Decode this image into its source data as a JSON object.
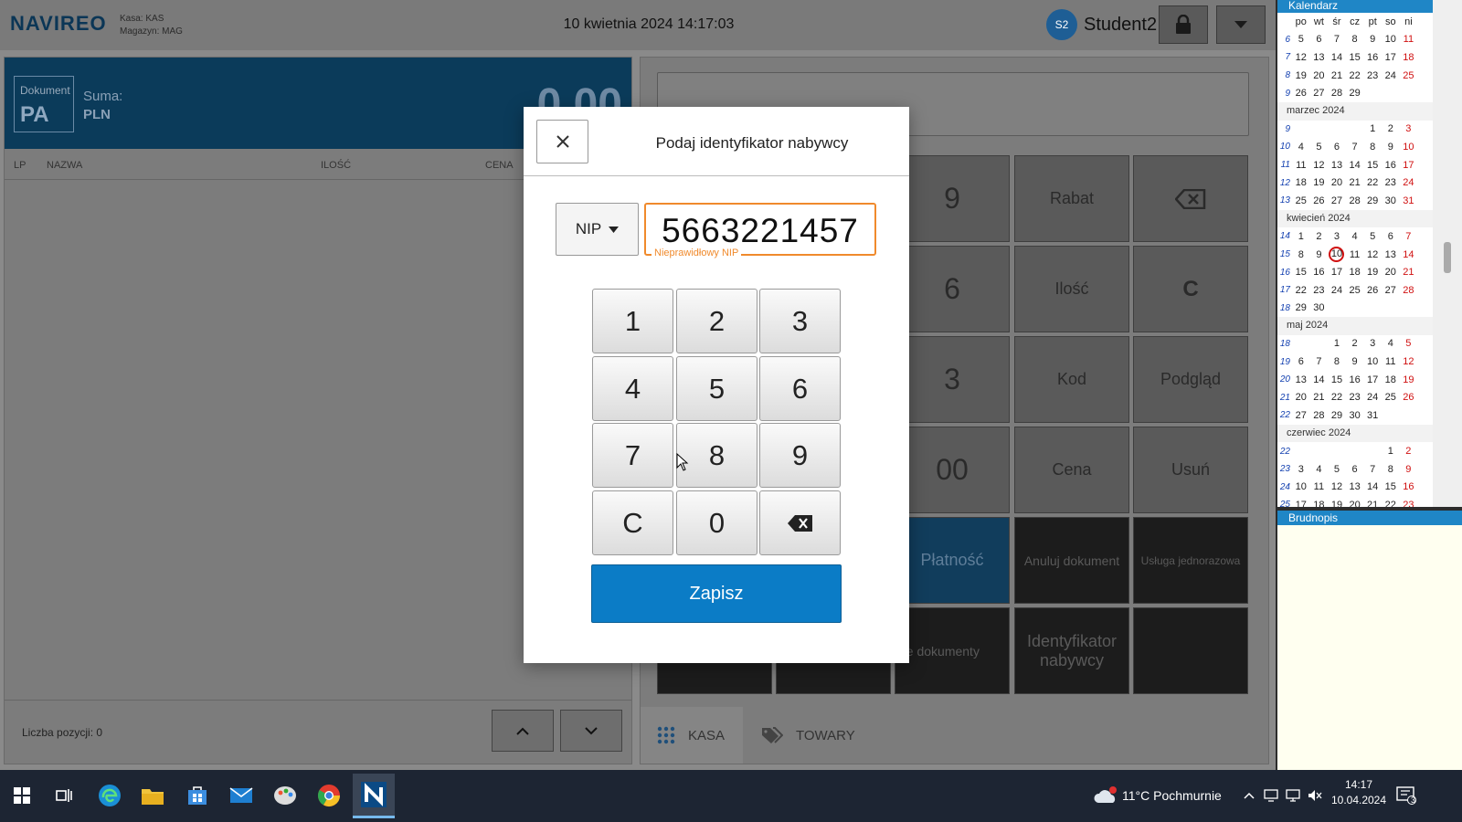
{
  "app": {
    "logo": "NAVIREO",
    "kasa_line": "Kasa: KAS",
    "magazyn_line": "Magazyn: MAG",
    "datetime": "10 kwietnia 2024 14:17:03",
    "avatar_initials": "S2",
    "username": "Student2"
  },
  "document": {
    "label": "Dokument",
    "type": "PA",
    "suma_label": "Suma:",
    "currency": "PLN",
    "total": "0,00"
  },
  "table": {
    "headers": [
      "LP",
      "NAZWA",
      "ILOŚĆ",
      "CENA"
    ]
  },
  "footer": {
    "count_text": "Liczba pozycji: 0"
  },
  "keypad_bg": {
    "r1": [
      "9",
      "Rabat"
    ],
    "r2": [
      "6",
      "Ilość",
      "C"
    ],
    "r3": [
      "3",
      "Kod",
      "Podgląd"
    ],
    "r4": [
      "00",
      "Cena",
      "Usuń"
    ],
    "r5": [
      "Płatność",
      "Anuluj dokument",
      "Usługa jednorazowa"
    ],
    "r6": [
      "ne dokumenty",
      "Identyfikator nabywcy"
    ]
  },
  "tabs": {
    "kasa": "KASA",
    "towary": "TOWARY"
  },
  "calendar": {
    "title": "Kalendarz",
    "weekdays": [
      "po",
      "wt",
      "śr",
      "cz",
      "pt",
      "so",
      "ni"
    ],
    "blocks": [
      {
        "month": "",
        "weeks": [
          [
            "6",
            "5",
            "6",
            "7",
            "8",
            "9",
            "10",
            "11"
          ],
          [
            "7",
            "12",
            "13",
            "14",
            "15",
            "16",
            "17",
            "18"
          ],
          [
            "8",
            "19",
            "20",
            "21",
            "22",
            "23",
            "24",
            "25"
          ],
          [
            "9",
            "26",
            "27",
            "28",
            "29",
            "",
            "",
            ""
          ]
        ]
      },
      {
        "month": "marzec 2024",
        "weeks": [
          [
            "9",
            "",
            "",
            "",
            "",
            "1",
            "2",
            "3"
          ],
          [
            "10",
            "4",
            "5",
            "6",
            "7",
            "8",
            "9",
            "10"
          ],
          [
            "11",
            "11",
            "12",
            "13",
            "14",
            "15",
            "16",
            "17"
          ],
          [
            "12",
            "18",
            "19",
            "20",
            "21",
            "22",
            "23",
            "24"
          ],
          [
            "13",
            "25",
            "26",
            "27",
            "28",
            "29",
            "30",
            "31"
          ]
        ]
      },
      {
        "month": "kwiecień 2024",
        "weeks": [
          [
            "14",
            "1",
            "2",
            "3",
            "4",
            "5",
            "6",
            "7"
          ],
          [
            "15",
            "8",
            "9",
            "10",
            "11",
            "12",
            "13",
            "14"
          ],
          [
            "16",
            "15",
            "16",
            "17",
            "18",
            "19",
            "20",
            "21"
          ],
          [
            "17",
            "22",
            "23",
            "24",
            "25",
            "26",
            "27",
            "28"
          ],
          [
            "18",
            "29",
            "30",
            "",
            "",
            "",
            "",
            ""
          ]
        ]
      },
      {
        "month": "maj 2024",
        "weeks": [
          [
            "18",
            "",
            "",
            "1",
            "2",
            "3",
            "4",
            "5"
          ],
          [
            "19",
            "6",
            "7",
            "8",
            "9",
            "10",
            "11",
            "12"
          ],
          [
            "20",
            "13",
            "14",
            "15",
            "16",
            "17",
            "18",
            "19"
          ],
          [
            "21",
            "20",
            "21",
            "22",
            "23",
            "24",
            "25",
            "26"
          ],
          [
            "22",
            "27",
            "28",
            "29",
            "30",
            "31",
            "",
            ""
          ]
        ]
      },
      {
        "month": "czerwiec 2024",
        "weeks": [
          [
            "22",
            "",
            "",
            "",
            "",
            "",
            "1",
            "2"
          ],
          [
            "23",
            "3",
            "4",
            "5",
            "6",
            "7",
            "8",
            "9"
          ],
          [
            "24",
            "10",
            "11",
            "12",
            "13",
            "14",
            "15",
            "16"
          ],
          [
            "25",
            "17",
            "18",
            "19",
            "20",
            "21",
            "22",
            "23"
          ]
        ]
      }
    ],
    "today": "10",
    "brudnopis_title": "Brudnopis"
  },
  "modal": {
    "title": "Podaj identyfikator nabywcy",
    "id_type": "NIP",
    "nip_value": "5663221457",
    "error_text": "Nieprawidłowy NIP",
    "pad_keys": [
      "1",
      "2",
      "3",
      "4",
      "5",
      "6",
      "7",
      "8",
      "9",
      "C",
      "0",
      "backspace-icon"
    ],
    "save_label": "Zapisz"
  },
  "taskbar": {
    "weather": "11°C  Pochmurnie",
    "time": "14:17",
    "date": "10.04.2024",
    "notif_count": "3",
    "weather_badge": "1"
  },
  "colors": {
    "accent": "#0b7cc6",
    "error": "#f08a2c",
    "doc_header": "#0b3b5a",
    "calendar_header": "#1f86c6"
  }
}
